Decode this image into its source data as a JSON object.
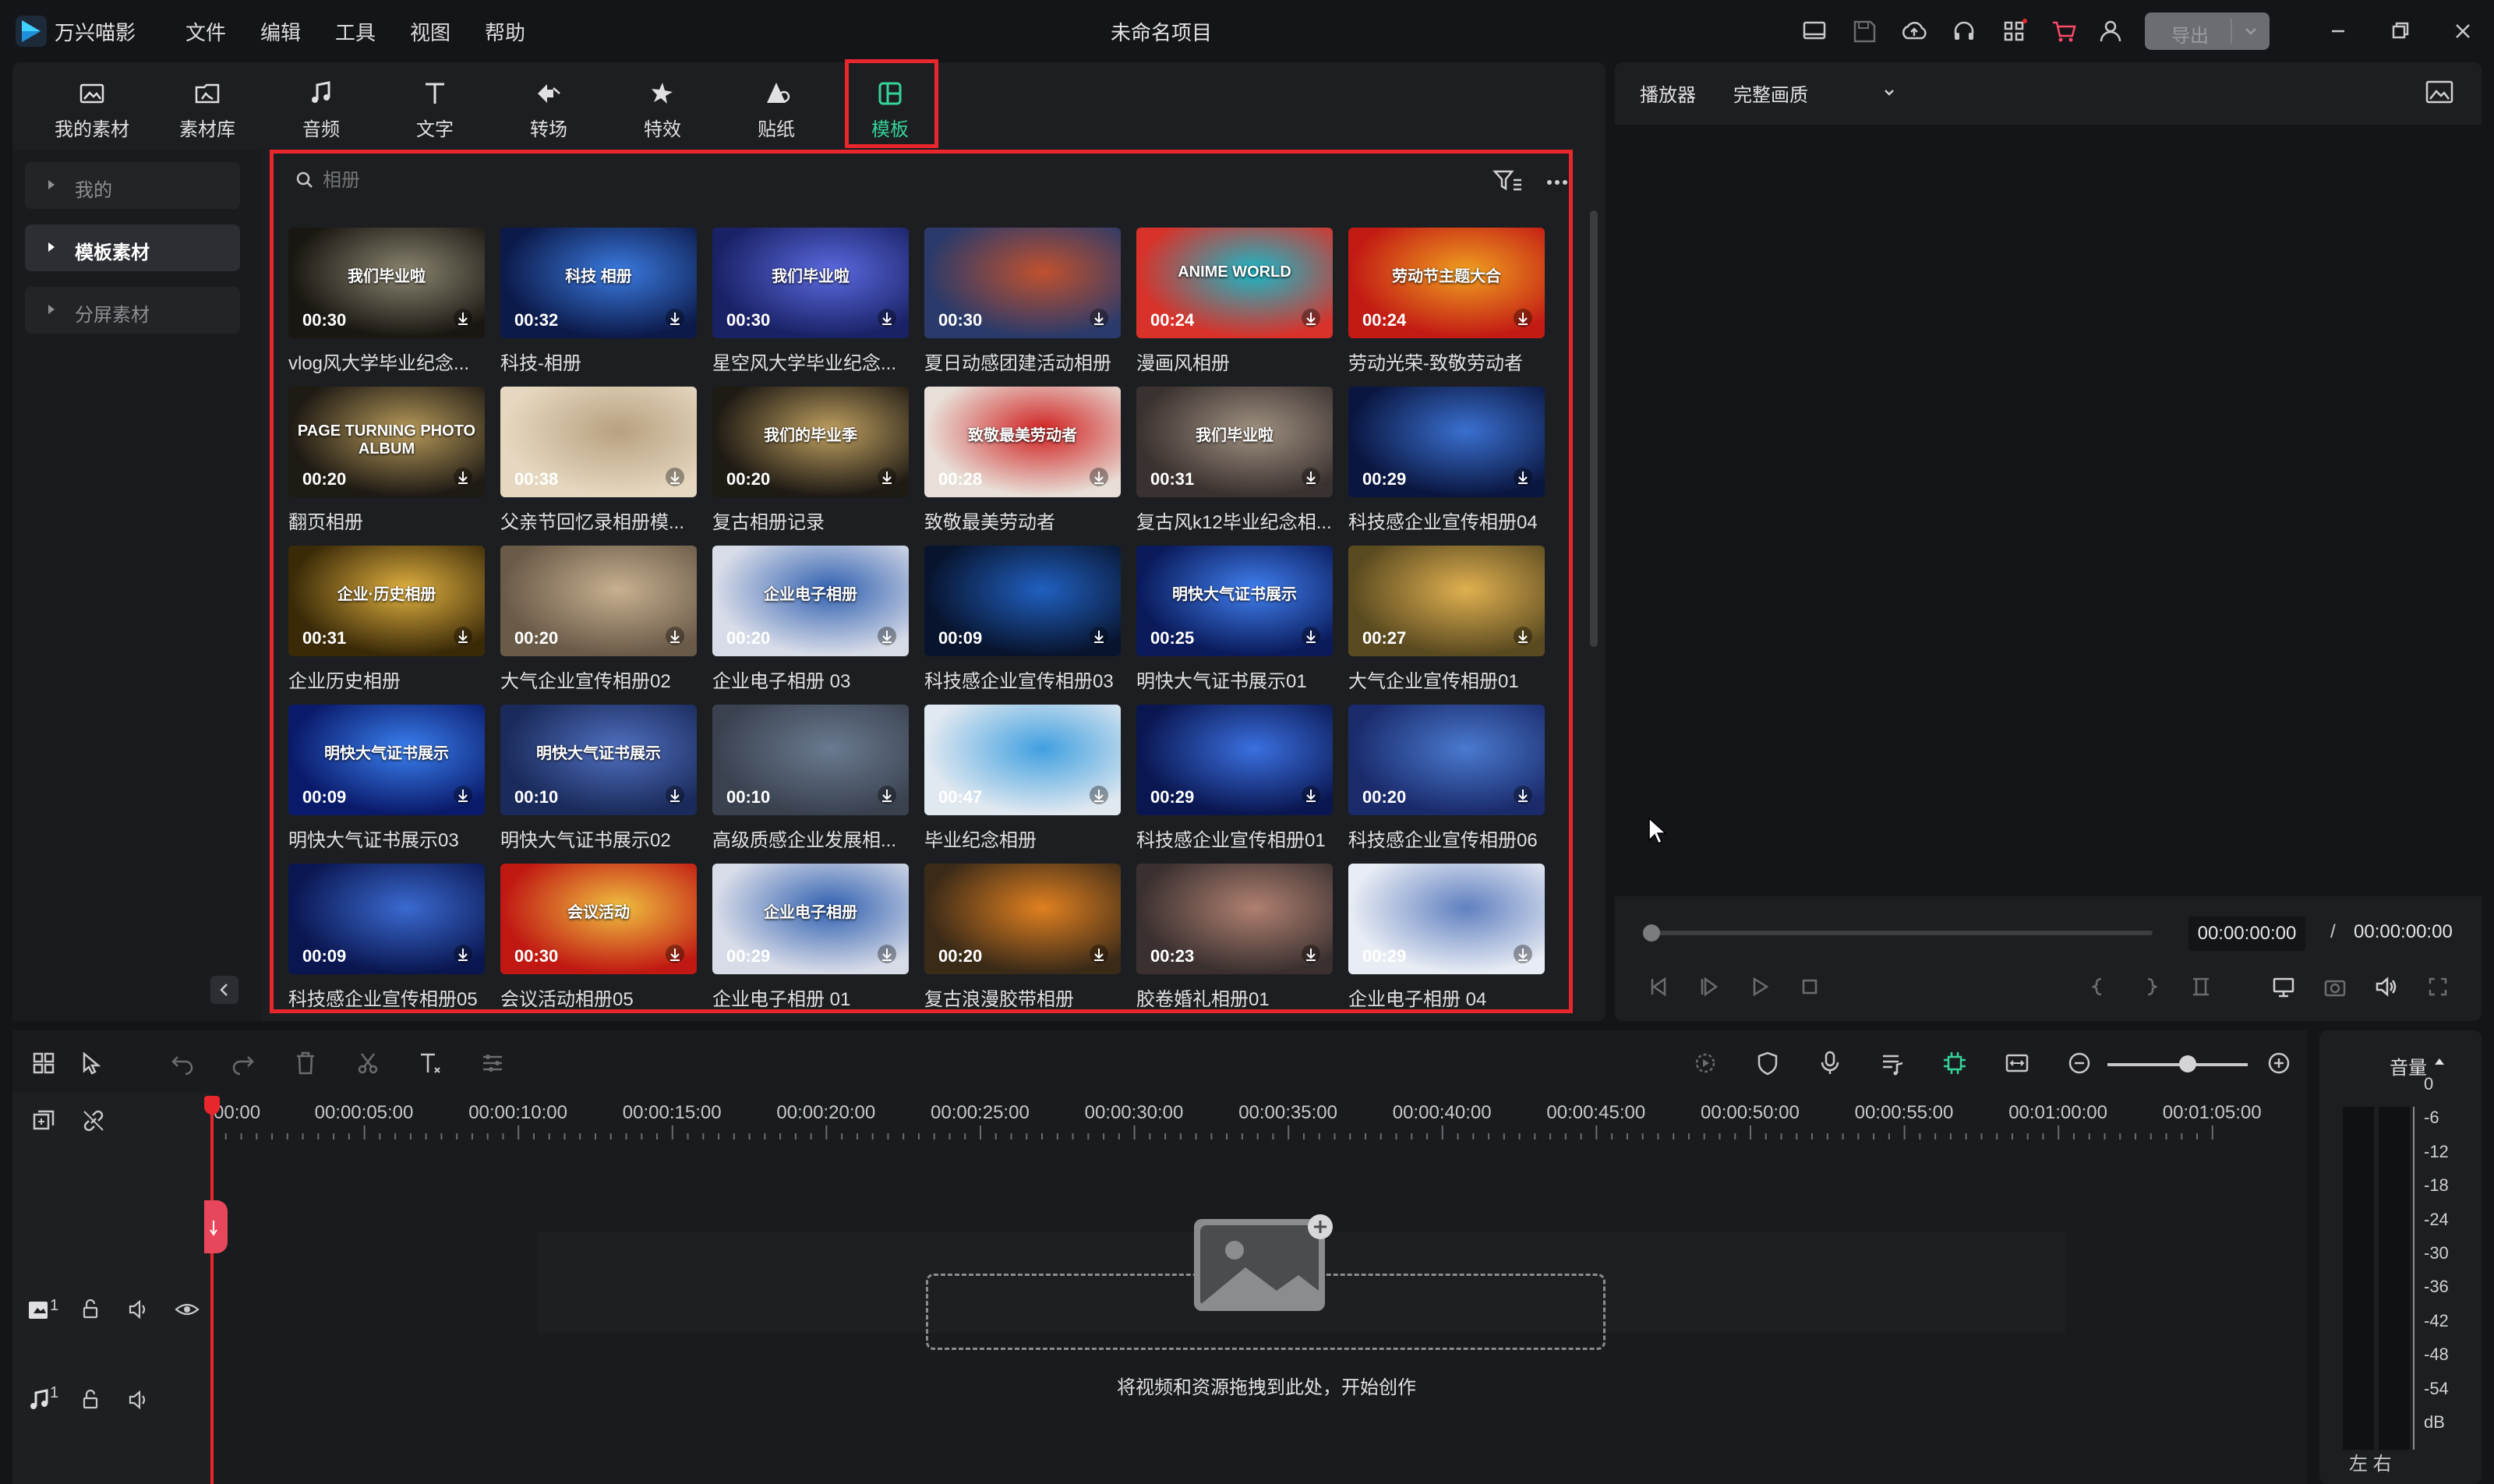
{
  "app": {
    "name": "万兴喵影",
    "project_title": "未命名项目",
    "export_label": "导出"
  },
  "menu": [
    "文件",
    "编辑",
    "工具",
    "视图",
    "帮助"
  ],
  "toolbar": {
    "tools": [
      {
        "label": "我的素材",
        "icon": "my-media-icon"
      },
      {
        "label": "素材库",
        "icon": "stock-media-icon"
      },
      {
        "label": "音频",
        "icon": "music-note-icon"
      },
      {
        "label": "文字",
        "icon": "text-icon"
      },
      {
        "label": "转场",
        "icon": "transition-icon"
      },
      {
        "label": "特效",
        "icon": "effects-icon"
      },
      {
        "label": "贴纸",
        "icon": "sticker-icon"
      },
      {
        "label": "模板",
        "icon": "template-icon"
      }
    ],
    "selected": "模板"
  },
  "categories": [
    {
      "label": "我的",
      "active": false
    },
    {
      "label": "模板素材",
      "active": true
    },
    {
      "label": "分屏素材",
      "active": false
    }
  ],
  "search": {
    "value": "",
    "placeholder": "相册"
  },
  "templates": [
    {
      "label": "vlog风大学毕业纪念...",
      "duration": "00:30",
      "bg": "#1a1712",
      "accent": "#8a8570",
      "text": "我们毕业啦"
    },
    {
      "label": "科技-相册",
      "duration": "00:32",
      "bg": "#0c1a4a",
      "accent": "#3b7be0",
      "text": "科技 相册"
    },
    {
      "label": "星空风大学毕业纪念...",
      "duration": "00:30",
      "bg": "#1a2266",
      "accent": "#5b6ae0",
      "text": "我们毕业啦"
    },
    {
      "label": "夏日动感团建活动相册",
      "duration": "00:30",
      "bg": "#2a3a6a",
      "accent": "#c0512e",
      "text": ""
    },
    {
      "label": "漫画风相册",
      "duration": "00:24",
      "bg": "#d8322a",
      "accent": "#19b8c8",
      "text": "ANIME WORLD"
    },
    {
      "label": "劳动光荣-致敬劳动者",
      "duration": "00:24",
      "bg": "#c21a14",
      "accent": "#f0a020",
      "text": "劳动节主题大合"
    },
    {
      "label": "翻页相册",
      "duration": "00:20",
      "bg": "#1e1a14",
      "accent": "#b89a5a",
      "text": "PAGE TURNING PHOTO ALBUM"
    },
    {
      "label": "父亲节回忆录相册模...",
      "duration": "00:38",
      "bg": "#e6d8c0",
      "accent": "#b8a080",
      "text": ""
    },
    {
      "label": "复古相册记录",
      "duration": "00:20",
      "bg": "#1e1a14",
      "accent": "#c0a060",
      "text": "我们的毕业季"
    },
    {
      "label": "致敬最美劳动者",
      "duration": "00:28",
      "bg": "#e8e0d8",
      "accent": "#d02020",
      "text": "致敬最美劳动者"
    },
    {
      "label": "复古风k12毕业纪念相...",
      "duration": "00:31",
      "bg": "#3a3230",
      "accent": "#a09080",
      "text": "我们毕业啦"
    },
    {
      "label": "科技感企业宣传相册04",
      "duration": "00:29",
      "bg": "#0a1640",
      "accent": "#3a70d0",
      "text": ""
    },
    {
      "label": "企业历史相册",
      "duration": "00:31",
      "bg": "#3a2a08",
      "accent": "#e0b040",
      "text": "企业·历史相册"
    },
    {
      "label": "大气企业宣传相册02",
      "duration": "00:20",
      "bg": "#6a5a48",
      "accent": "#c8b090",
      "text": ""
    },
    {
      "label": "企业电子相册 03",
      "duration": "00:20",
      "bg": "#d8dce8",
      "accent": "#3060b0",
      "text": "企业电子相册"
    },
    {
      "label": "科技感企业宣传相册03",
      "duration": "00:09",
      "bg": "#08142e",
      "accent": "#2060c0",
      "text": ""
    },
    {
      "label": "明快大气证书展示01",
      "duration": "00:25",
      "bg": "#0a1a5a",
      "accent": "#4080f0",
      "text": "明快大气证书展示"
    },
    {
      "label": "大气企业宣传相册01",
      "duration": "00:27",
      "bg": "#5a4a20",
      "accent": "#e0b050",
      "text": ""
    },
    {
      "label": "明快大气证书展示03",
      "duration": "00:09",
      "bg": "#0a1a6a",
      "accent": "#3a80f0",
      "text": "明快大气证书展示"
    },
    {
      "label": "明快大气证书展示02",
      "duration": "00:10",
      "bg": "#1a2a5a",
      "accent": "#5070c0",
      "text": "明快大气证书展示"
    },
    {
      "label": "高级质感企业发展相...",
      "duration": "00:10",
      "bg": "#3a4250",
      "accent": "#6a7a90",
      "text": ""
    },
    {
      "label": "毕业纪念相册",
      "duration": "00:47",
      "bg": "#e0e8f0",
      "accent": "#40a0e0",
      "text": ""
    },
    {
      "label": "科技感企业宣传相册01",
      "duration": "00:29",
      "bg": "#0a1650",
      "accent": "#3a70e0",
      "text": ""
    },
    {
      "label": "科技感企业宣传相册06",
      "duration": "00:20",
      "bg": "#1a2a6a",
      "accent": "#4a7ad0",
      "text": ""
    },
    {
      "label": "科技感企业宣传相册05",
      "duration": "00:09",
      "bg": "#0a1650",
      "accent": "#3a6ad0",
      "text": ""
    },
    {
      "label": "会议活动相册05",
      "duration": "00:30",
      "bg": "#c01812",
      "accent": "#f0c040",
      "text": "会议活动"
    },
    {
      "label": "企业电子相册 01",
      "duration": "00:29",
      "bg": "#d8dce8",
      "accent": "#3060b0",
      "text": "企业电子相册"
    },
    {
      "label": "复古浪漫胶带相册",
      "duration": "00:20",
      "bg": "#3a2a18",
      "accent": "#e08020",
      "text": ""
    },
    {
      "label": "胶卷婚礼相册01",
      "duration": "00:23",
      "bg": "#3a3030",
      "accent": "#b08070",
      "text": ""
    },
    {
      "label": "企业电子相册 04",
      "duration": "00:29",
      "bg": "#e8ecf4",
      "accent": "#6080c0",
      "text": ""
    }
  ],
  "player": {
    "tab_label": "播放器",
    "quality": "完整画质",
    "current_time": "00:00:00:00",
    "separator": "/",
    "total_time": "00:00:00:00"
  },
  "timeline": {
    "ticks": [
      "00:00",
      "00:00:05:00",
      "00:00:10:00",
      "00:00:15:00",
      "00:00:20:00",
      "00:00:25:00",
      "00:00:30:00",
      "00:00:35:00",
      "00:00:40:00",
      "00:00:45:00",
      "00:00:50:00",
      "00:00:55:00",
      "00:01:00:00",
      "00:01:05:00"
    ],
    "drop_hint": "将视频和资源拖拽到此处，开始创作",
    "video_track_num": "1",
    "audio_track_num": "1"
  },
  "audio": {
    "volume_label": "音量",
    "db_scale": [
      "0",
      "-6",
      "-12",
      "-18",
      "-24",
      "-30",
      "-36",
      "-42",
      "-48",
      "-54",
      "dB"
    ],
    "lr": "左 右"
  },
  "colors": {
    "accent_red": "#e8262c",
    "accent_green": "#36d399",
    "panel": "#1d1e21",
    "bg": "#141518"
  }
}
